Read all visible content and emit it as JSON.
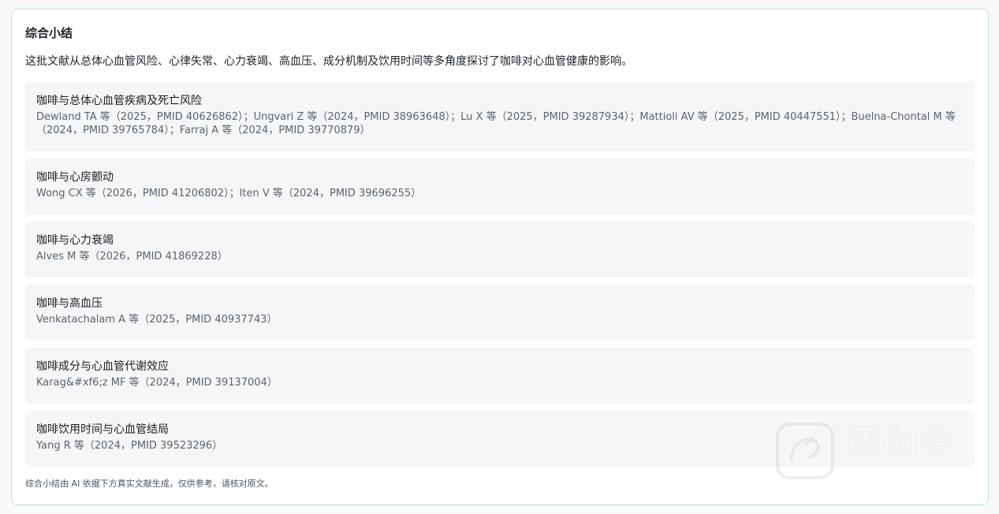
{
  "summary": {
    "title": "综合小结",
    "intro": "这批文献从总体心血管风险、心律失常、心力衰竭、高血压、成分机制及饮用时间等多角度探讨了咖啡对心血管健康的影响。",
    "items": [
      {
        "title": "咖啡与总体心血管疾病及死亡风险",
        "refs": "Dewland TA 等（2025，PMID 40626862）；Ungvari Z 等（2024，PMID 38963648）；Lu X 等（2025，PMID 39287934）；Mattioli AV 等（2025，PMID 40447551）；Buelna-Chontal M 等（2024，PMID 39765784）；Farraj A 等（2024，PMID 39770879）"
      },
      {
        "title": "咖啡与心房颤动",
        "refs": "Wong CX 等（2026，PMID 41206802）；Iten V 等（2024，PMID 39696255）"
      },
      {
        "title": "咖啡与心力衰竭",
        "refs": "Alves M 等（2026，PMID 41869228）"
      },
      {
        "title": "咖啡与高血压",
        "refs": "Venkatachalam A 等（2025，PMID 40937743）"
      },
      {
        "title": "咖啡成分与心血管代谢效应",
        "refs": "Karag&#xf6;z MF 等（2024，PMID 39137004）"
      },
      {
        "title": "咖啡饮用时间与心血管结局",
        "refs": "Yang R 等（2024，PMID 39523296）"
      }
    ],
    "footer_note": "综合小结由 AI 依据下方真实文献生成，仅供参考，请核对原文。"
  },
  "watermark": {
    "text": "医咖会"
  }
}
